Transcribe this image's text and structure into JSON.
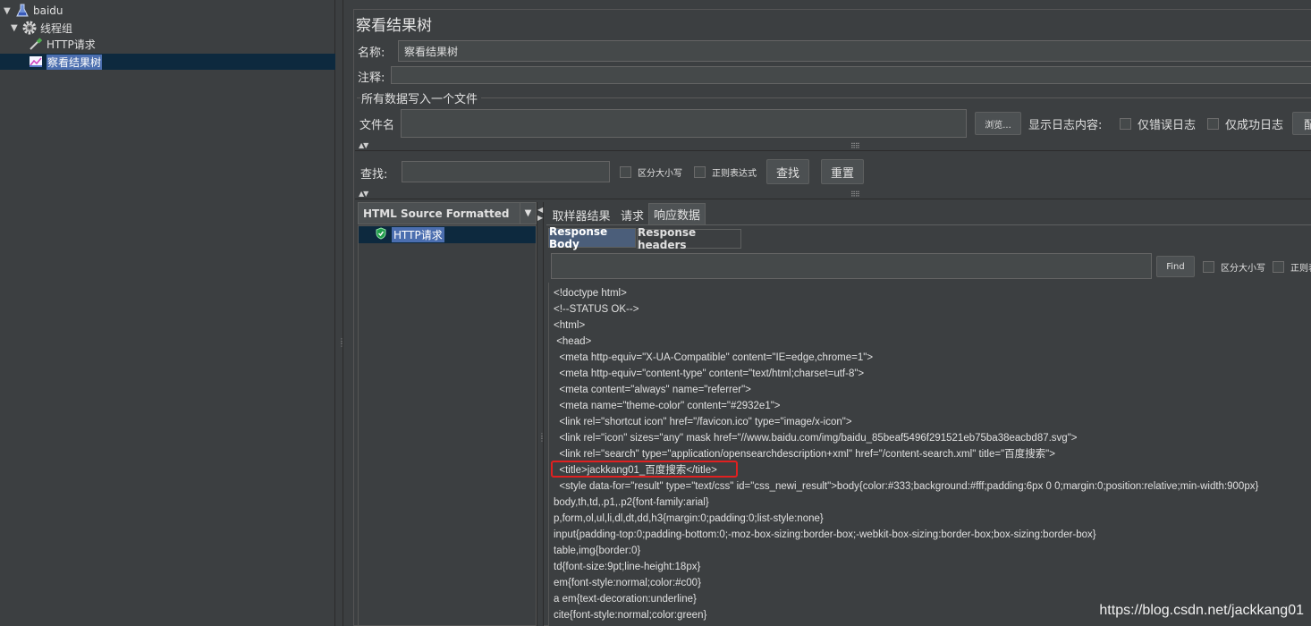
{
  "tree": {
    "items": [
      {
        "label": "baidu",
        "icon": "flask-icon"
      },
      {
        "label": "线程组",
        "icon": "gear-icon"
      },
      {
        "label": "HTTP请求",
        "icon": "pipette-icon"
      },
      {
        "label": "察看结果树",
        "icon": "chart-icon"
      }
    ]
  },
  "panel": {
    "title": "察看结果树",
    "name_label": "名称:",
    "name_value": "察看结果树",
    "comment_label": "注释:",
    "comment_value": "",
    "file_section": "所有数据写入一个文件",
    "file_label": "文件名",
    "file_value": "",
    "browse_button": "浏览...",
    "log_label": "显示日志内容:",
    "errors_only": "仅错误日志",
    "success_only": "仅成功日志",
    "config_button": "配"
  },
  "search": {
    "label": "查找:",
    "value": "",
    "case_sensitive": "区分大小写",
    "regex": "正则表达式",
    "find_button": "查找",
    "reset_button": "重置"
  },
  "renderer": {
    "selected": "HTML Source Formatted"
  },
  "samples": [
    {
      "label": "HTTP请求",
      "status": "success"
    }
  ],
  "result_tabs": [
    "取样器结果",
    "请求",
    "响应数据"
  ],
  "active_result_tab": "响应数据",
  "response_tabs": [
    "Response Body",
    "Response headers"
  ],
  "active_response_tab": "Response Body",
  "body_search": {
    "value": "",
    "find_button": "Find",
    "case_sensitive": "区分大小写",
    "regex": "正则表"
  },
  "response_body_lines": [
    "<!doctype html>",
    "<!--STATUS OK-->",
    "<html>",
    " <head>",
    "  <meta http-equiv=\"X-UA-Compatible\" content=\"IE=edge,chrome=1\">",
    "  <meta http-equiv=\"content-type\" content=\"text/html;charset=utf-8\">",
    "  <meta content=\"always\" name=\"referrer\">",
    "  <meta name=\"theme-color\" content=\"#2932e1\">",
    "  <link rel=\"shortcut icon\" href=\"/favicon.ico\" type=\"image/x-icon\">",
    "  <link rel=\"icon\" sizes=\"any\" mask href=\"//www.baidu.com/img/baidu_85beaf5496f291521eb75ba38eacbd87.svg\">",
    "  <link rel=\"search\" type=\"application/opensearchdescription+xml\" href=\"/content-search.xml\" title=\"百度搜索\">",
    "  <title>jackkang01_百度搜索</title>",
    "  <style data-for=\"result\" type=\"text/css\" id=\"css_newi_result\">body{color:#333;background:#fff;padding:6px 0 0;margin:0;position:relative;min-width:900px}",
    "body,th,td,.p1,.p2{font-family:arial}",
    "p,form,ol,ul,li,dl,dt,dd,h3{margin:0;padding:0;list-style:none}",
    "input{padding-top:0;padding-bottom:0;-moz-box-sizing:border-box;-webkit-box-sizing:border-box;box-sizing:border-box}",
    "table,img{border:0}",
    "td{font-size:9pt;line-height:18px}",
    "em{font-style:normal;color:#c00}",
    "a em{text-decoration:underline}",
    "cite{font-style:normal;color:green}"
  ],
  "watermark": "https://blog.csdn.net/jackkang01"
}
